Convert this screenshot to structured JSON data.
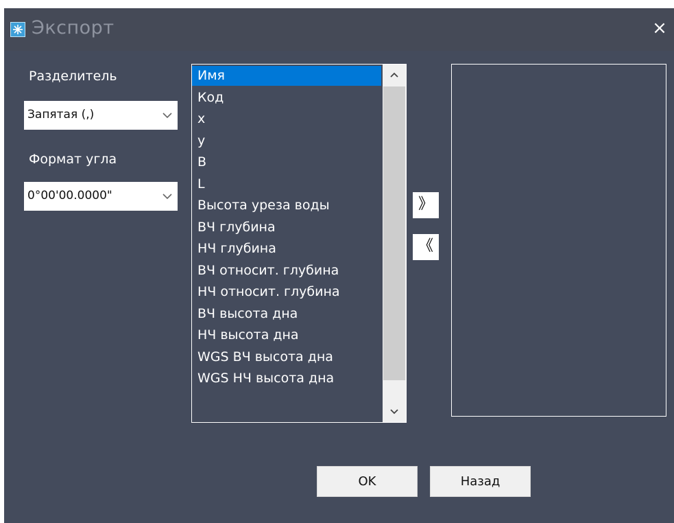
{
  "window": {
    "title": "Экспорт",
    "close_label": "×"
  },
  "separator": {
    "label": "Разделитель",
    "value": "Запятая (,)"
  },
  "angle_format": {
    "label": "Формат угла",
    "value": "0°00'00.0000\""
  },
  "fields": [
    "Имя",
    "Код",
    "x",
    "y",
    "B",
    "L",
    "Высота уреза воды",
    "ВЧ глубина",
    "НЧ глубина",
    "ВЧ относит. глубина",
    "НЧ относит. глубина",
    "ВЧ высота дна",
    "НЧ высота дна",
    "WGS ВЧ высота дна",
    "WGS НЧ высота дна"
  ],
  "selected_field_index": 0,
  "move_buttons": {
    "add": "》",
    "remove": "《"
  },
  "actions": {
    "ok": "OK",
    "back": "Назад"
  },
  "colors": {
    "background": "#444b5c",
    "selection": "#0078d7"
  }
}
